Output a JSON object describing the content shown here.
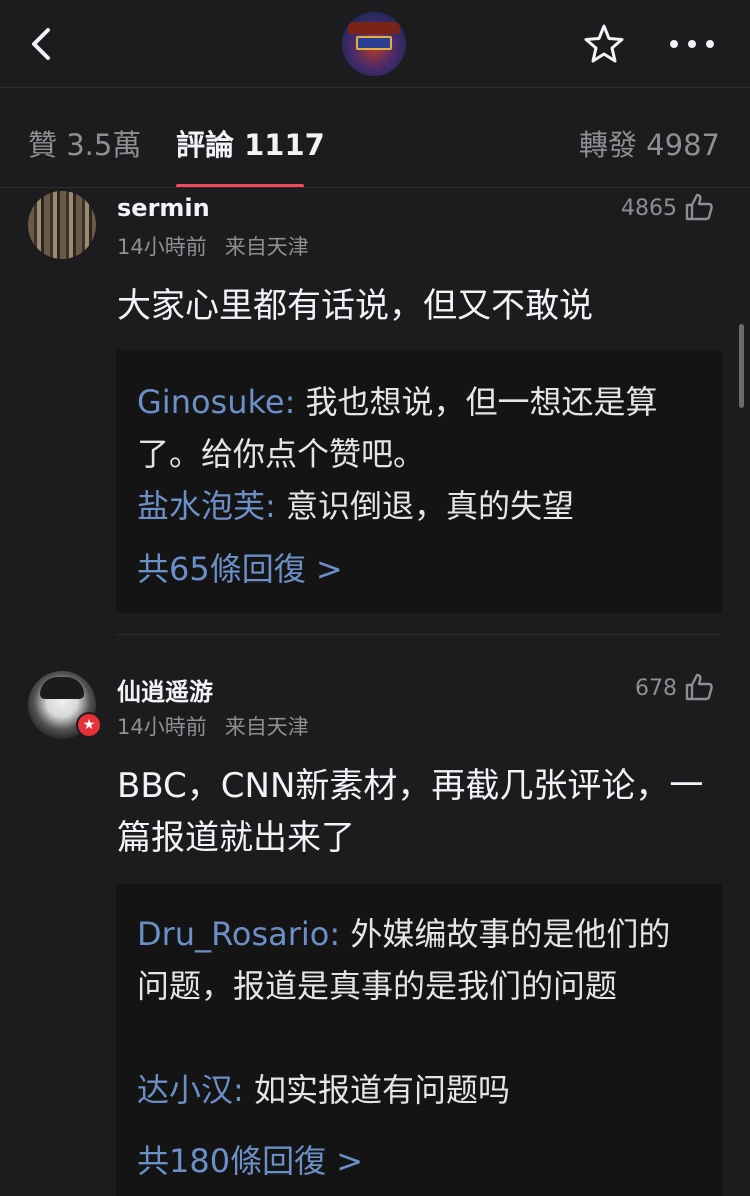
{
  "tabs": {
    "likes": "贊 3.5萬",
    "comments": "評論 1117",
    "reposts": "轉發 4987"
  },
  "comments": [
    {
      "username": "sermin",
      "time": "14小時前",
      "location": "来自天津",
      "likes": "4865",
      "text": "大家心里都有话说，但又不敢说",
      "replies": [
        {
          "name": "Ginosuke",
          "sep": ": ",
          "text": "我也想说，但一想还是算了。给你点个赞吧。"
        },
        {
          "name": "盐水泡芙",
          "sep": ": ",
          "text": "意识倒退，真的失望"
        }
      ],
      "more": "共65條回復 >"
    },
    {
      "username": "仙逍遥游",
      "time": "14小時前",
      "location": "来自天津",
      "likes": "678",
      "text": "BBC，CNN新素材，再截几张评论，一篇报道就出来了",
      "replies": [
        {
          "name": "Dru_Rosario",
          "sep": ": ",
          "text": "外媒编故事的是他们的问题，报道是真事的是我们的问题"
        },
        {
          "name": "达小汉",
          "sep": ": ",
          "text": "如实报道有问题吗"
        }
      ],
      "more": "共180條回復 >"
    }
  ],
  "icons": {
    "back": "chevron-left-icon",
    "favorite": "star-icon",
    "more": "more-icon",
    "like": "thumbs-up-icon"
  },
  "colors": {
    "background": "#1c1c1e",
    "accent": "#f24a5b",
    "link": "#6b8fc6"
  }
}
